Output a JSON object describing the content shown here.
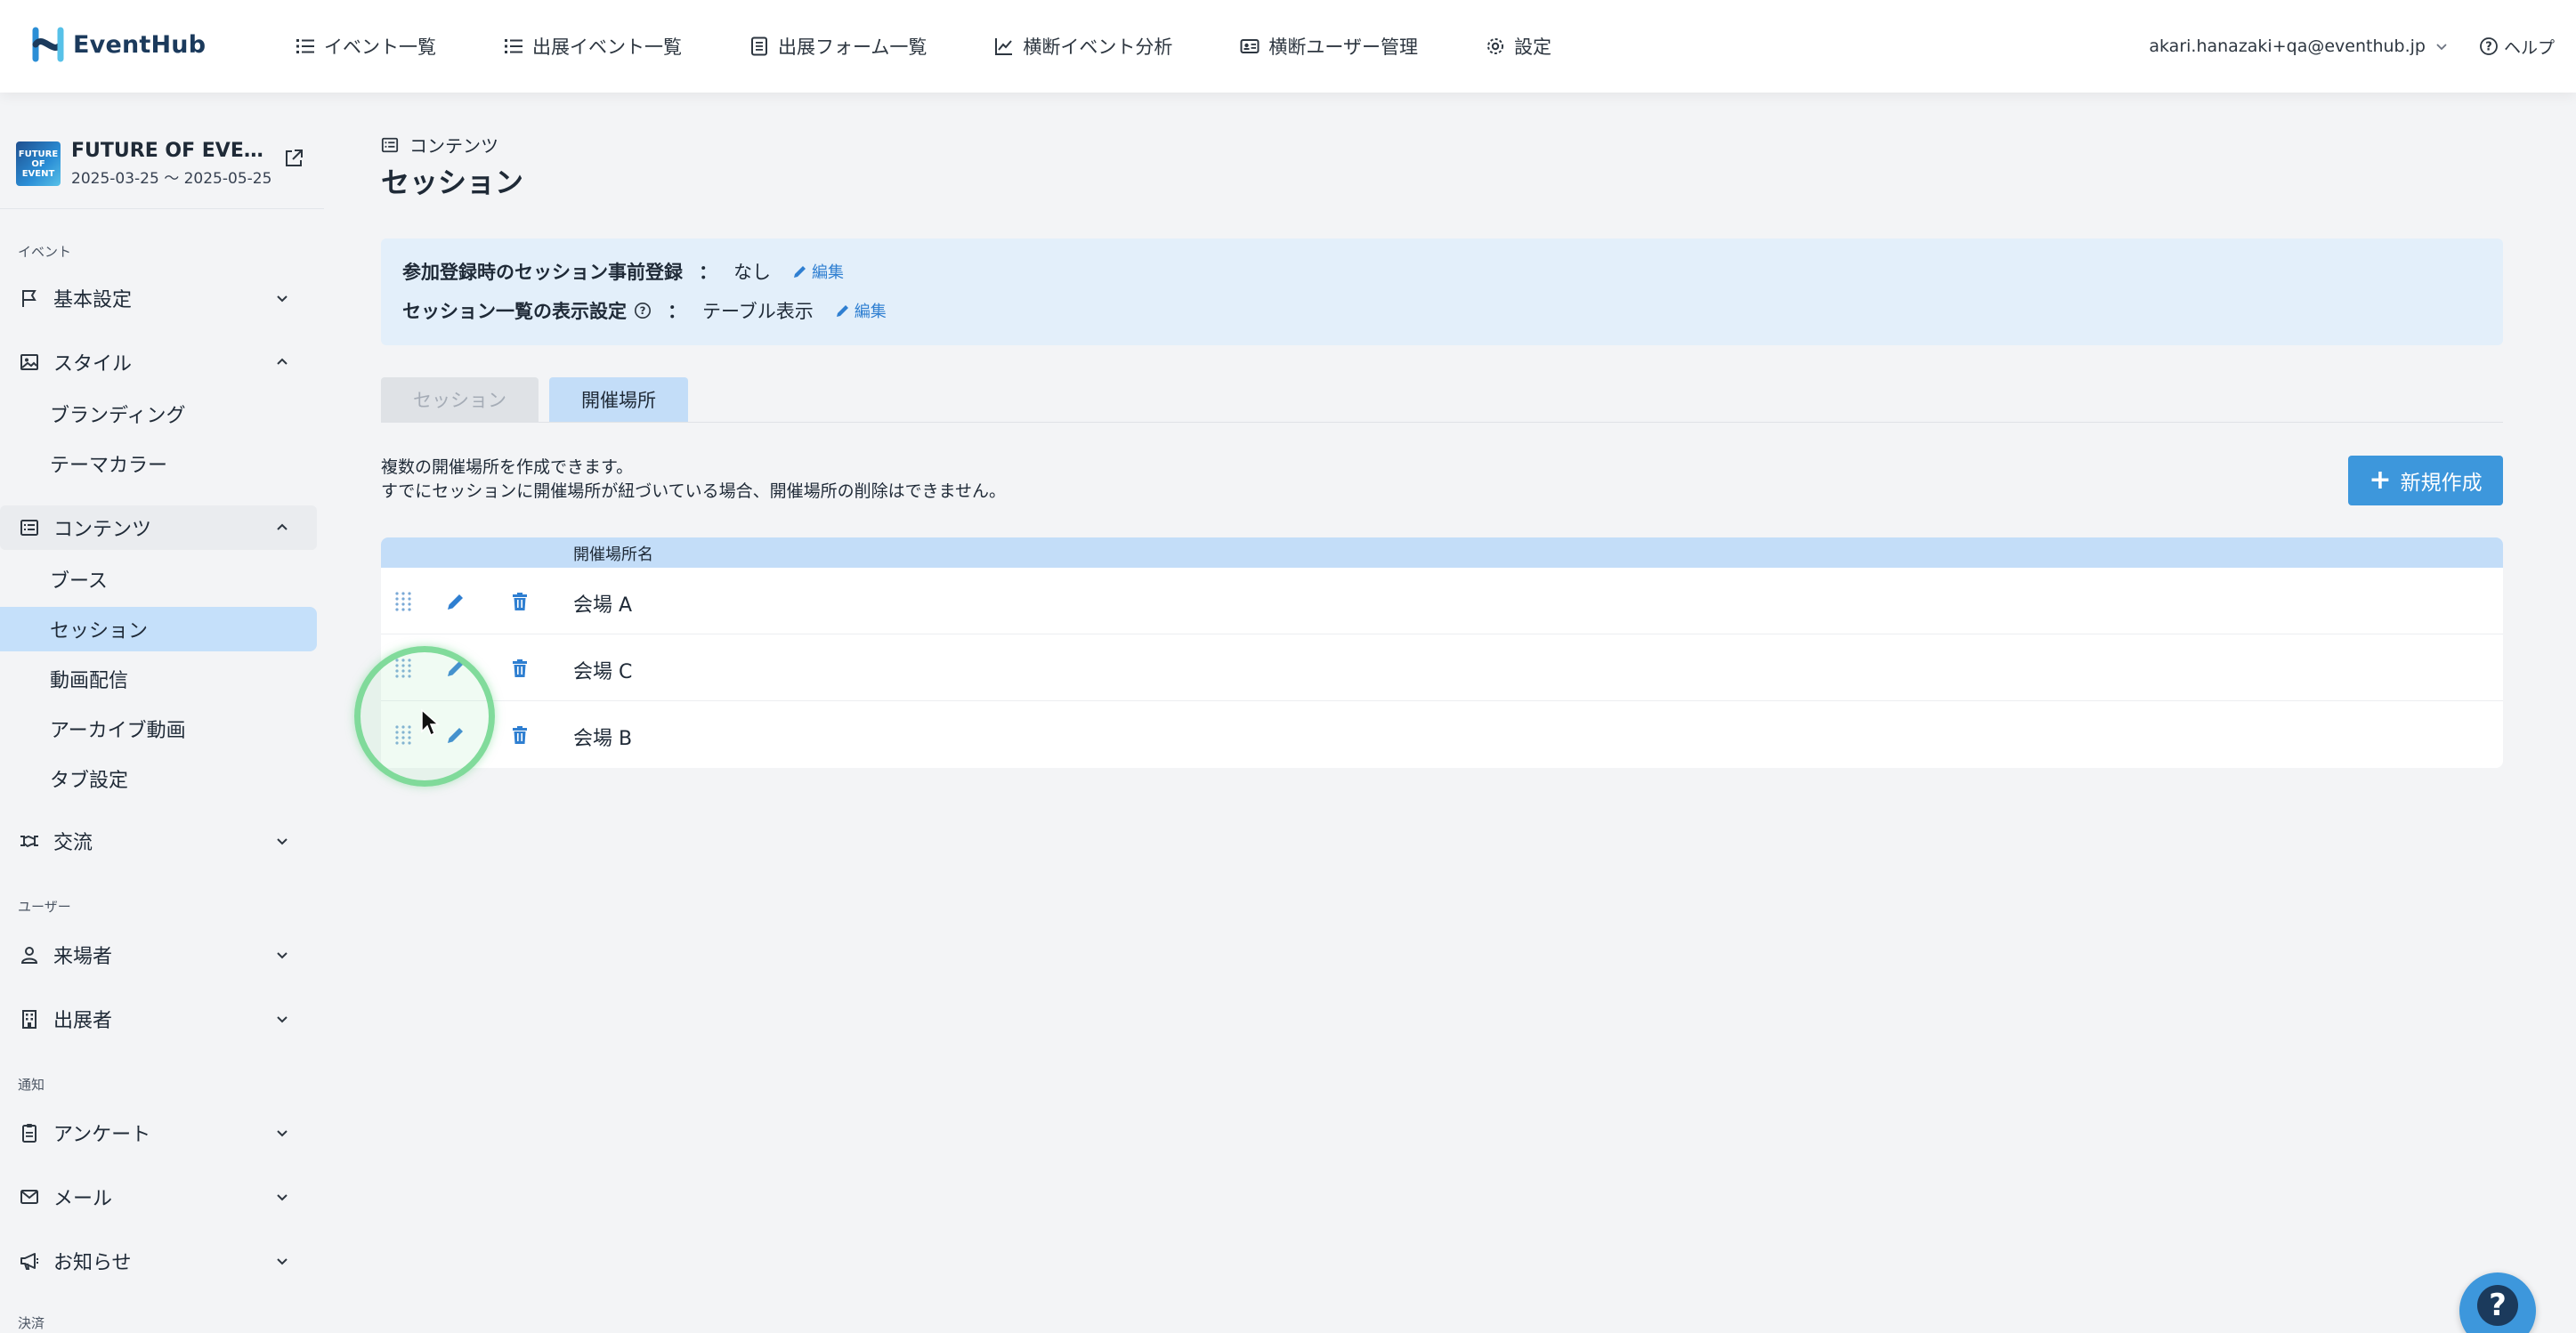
{
  "header": {
    "logo_text": "EventHub",
    "nav": [
      {
        "label": "イベント一覧",
        "icon": "list-icon"
      },
      {
        "label": "出展イベント一覧",
        "icon": "list-icon"
      },
      {
        "label": "出展フォーム一覧",
        "icon": "form-icon"
      },
      {
        "label": "横断イベント分析",
        "icon": "chart-line-icon"
      },
      {
        "label": "横断ユーザー管理",
        "icon": "id-card-icon"
      },
      {
        "label": "設定",
        "icon": "gear-icon"
      }
    ],
    "user_email": "akari.hanazaki+qa@eventhub.jp",
    "help_label": "ヘルプ"
  },
  "sidebar": {
    "event": {
      "thumb_text": "FUTURE OF EVENT",
      "name": "FUTURE OF EVEN…",
      "dates": "2025-03-25 〜 2025-05-25"
    },
    "sections": {
      "event": "イベント",
      "user": "ユーザー",
      "notify": "通知",
      "payment": "決済"
    },
    "items": {
      "basic": "基本設定",
      "style": "スタイル",
      "branding": "ブランディング",
      "theme_color": "テーマカラー",
      "contents": "コンテンツ",
      "booth": "ブース",
      "session": "セッション",
      "streaming": "動画配信",
      "archive": "アーカイブ動画",
      "tab_settings": "タブ設定",
      "exchange": "交流",
      "visitors": "来場者",
      "exhibitors": "出展者",
      "survey": "アンケート",
      "mail": "メール",
      "notice": "お知らせ"
    }
  },
  "main": {
    "breadcrumb": "コンテンツ",
    "title": "セッション",
    "info": {
      "row1_label": "参加登録時のセッション事前登録",
      "row1_colon": "：",
      "row1_value": "なし",
      "row2_label": "セッション一覧の表示設定",
      "row2_colon": "：",
      "row2_value": "テーブル表示",
      "edit_label": "編集"
    },
    "tabs": [
      "セッション",
      "開催場所"
    ],
    "active_tab": "開催場所",
    "description_line1": "複数の開催場所を作成できます。",
    "description_line2": "すでにセッションに開催場所が紐づいている場合、開催場所の削除はできません。",
    "new_button": "新規作成",
    "new_button_plus": "+",
    "table": {
      "header": "開催場所名",
      "rows": [
        {
          "name": "会場 A"
        },
        {
          "name": "会場 C"
        },
        {
          "name": "会場 B"
        }
      ]
    }
  },
  "help_fab": "?",
  "colors": {
    "accent": "#3d97dc",
    "active_bg": "#c5e0fa",
    "info_bg": "#e3effa",
    "link": "#2f7fd1",
    "click_ring": "#6fd68c"
  }
}
